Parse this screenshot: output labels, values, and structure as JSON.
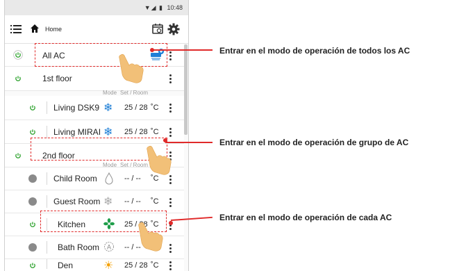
{
  "status_bar": {
    "time": "10:48",
    "icons": "▼◢ ▮"
  },
  "toolbar": {
    "title": "Home"
  },
  "columns": {
    "mode": "Mode",
    "set_room": "Set / Room"
  },
  "rows": [
    {
      "label": "All AC",
      "type": "all",
      "icon": "all-ac-icon"
    },
    {
      "label": "1st floor",
      "type": "group"
    },
    {
      "label": "Living DSK9",
      "type": "unit",
      "mode": "cool-snowflake-icon",
      "temp": "25 / 28",
      "unit": "˚C"
    },
    {
      "label": "Living MIRAI",
      "type": "unit",
      "mode": "cool-snowflake-icon",
      "temp": "25 / 28",
      "unit": "˚C"
    },
    {
      "label": "2nd floor",
      "type": "group"
    },
    {
      "label": "Child Room",
      "type": "unit",
      "mode": "dry-drop-icon",
      "temp": "-- / --",
      "unit": "˚C"
    },
    {
      "label": "Guest Room",
      "type": "unit",
      "mode": "cool-snowflake-icon",
      "temp": "-- / --",
      "unit": "˚C"
    },
    {
      "label": "Kitchen",
      "type": "unit",
      "mode": "fan-icon",
      "temp": "25 / 28",
      "unit": "˚C"
    },
    {
      "label": "Bath Room",
      "type": "unit",
      "mode": "auto-icon",
      "temp": "-- / --",
      "unit": "˚C"
    },
    {
      "label": "Den",
      "type": "unit",
      "mode": "heat-sun-icon",
      "temp": "25 / 28",
      "unit": "˚C"
    }
  ],
  "annotations": {
    "all": "Entrar en el modo de operación de todos los AC",
    "group": "Entrar en el modo de operación de grupo de AC",
    "each": "Entrar en el modo de operación de cada AC"
  },
  "colors": {
    "callout": "#e02a2a",
    "power_on": "#2aa02a",
    "cool": "#1e7fd6",
    "fan": "#1f9e4a",
    "heat": "#f5a000"
  }
}
